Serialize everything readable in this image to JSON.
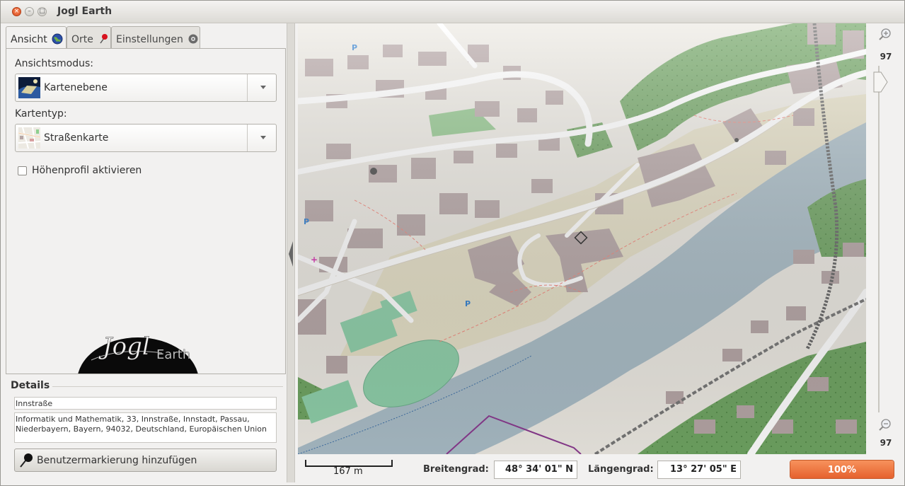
{
  "window": {
    "title": "Jogl Earth"
  },
  "tabs": [
    {
      "label": "Ansicht",
      "icon": "globe-icon"
    },
    {
      "label": "Orte",
      "icon": "pin-icon"
    },
    {
      "label": "Einstellungen",
      "icon": "gear-icon"
    }
  ],
  "view": {
    "mode_label": "Ansichtsmodus:",
    "mode_value": "Kartenebene",
    "maptype_label": "Kartentyp:",
    "maptype_value": "Straßenkarte",
    "elevation_label": "Höhenprofil aktivieren",
    "elevation_checked": false,
    "logo_text": "Jogl",
    "logo_text2": "Earth"
  },
  "details": {
    "header": "Details",
    "name": "Innstraße",
    "address": "Informatik und Mathematik, 33, Innstraße, Innstadt, Passau, Niederbayern, Bayern, 94032, Deutschland, Europäischen Union",
    "add_marker_label": "Benutzermarkierung hinzufügen"
  },
  "zoom": {
    "top_value": "97",
    "bottom_value": "97",
    "level": 0.12
  },
  "status": {
    "scale_label": "167 m",
    "lat_label": "Breitengrad:",
    "lat_value": "48° 34' 01\" N",
    "lon_label": "Längengrad:",
    "lon_value": "13° 27' 05\" E",
    "progress_label": "100%",
    "progress": 1.0
  },
  "colors": {
    "water": "#a9bcc6",
    "forest": "#6fa462",
    "building": "#b6a6a6",
    "land": "#ece9e2",
    "pitch": "#8ecfa9",
    "accent": "#e5612e"
  }
}
